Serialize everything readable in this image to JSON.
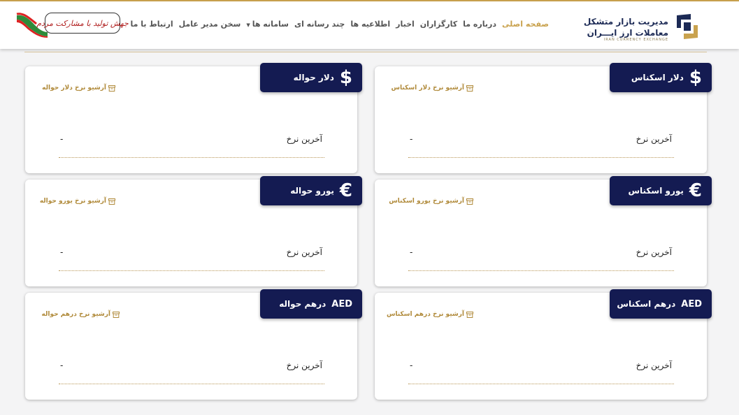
{
  "header": {
    "logo_line1": "مدیریت بازار متشکل",
    "logo_line2": "معاملات ارز ایـــران",
    "logo_line3": "IRAN CURRENCY EXCHANGE",
    "slogan": "جهش تولید با مشارکت مردم"
  },
  "nav": {
    "home": "صفحه اصلی",
    "about": "درباره ما",
    "brokers": "کارگزاران",
    "news": "اخبار",
    "announcements": "اطلاعیه ها",
    "multimedia": "چند رسانه ای",
    "systems": "سامانه ها",
    "ceo_message": "سخن مدیر عامل",
    "contact": "ارتباط با ما"
  },
  "cards": {
    "dollar_cash": {
      "title": "دلار اسکناس",
      "symbol": "$",
      "archive": "آرشیو نرخ دلار اسکناس",
      "rate_label": "آخرین نرخ",
      "rate_value": "-"
    },
    "dollar_transfer": {
      "title": "دلار حواله",
      "symbol": "$",
      "archive": "آرشیو نرخ دلار حواله",
      "rate_label": "آخرین نرخ",
      "rate_value": "-"
    },
    "euro_cash": {
      "title": "یورو اسکناس",
      "symbol": "€",
      "archive": "آرشیو نرخ یورو اسکناس",
      "rate_label": "آخرین نرخ",
      "rate_value": "-"
    },
    "euro_transfer": {
      "title": "یورو حواله",
      "symbol": "€",
      "archive": "آرشیو نرخ یورو حواله",
      "rate_label": "آخرین نرخ",
      "rate_value": "-"
    },
    "aed_cash": {
      "title": "درهم اسکناس",
      "symbol": "AED",
      "archive": "آرشیو نرخ درهم اسکناس",
      "rate_label": "آخرین نرخ",
      "rate_value": "-"
    },
    "aed_transfer": {
      "title": "درهم حواله",
      "symbol": "AED",
      "archive": "آرشیو نرخ درهم حواله",
      "rate_label": "آخرین نرخ",
      "rate_value": "-"
    }
  },
  "colors": {
    "accent": "#c9a24e",
    "navy": "#141b52",
    "link": "#b08a3a"
  }
}
